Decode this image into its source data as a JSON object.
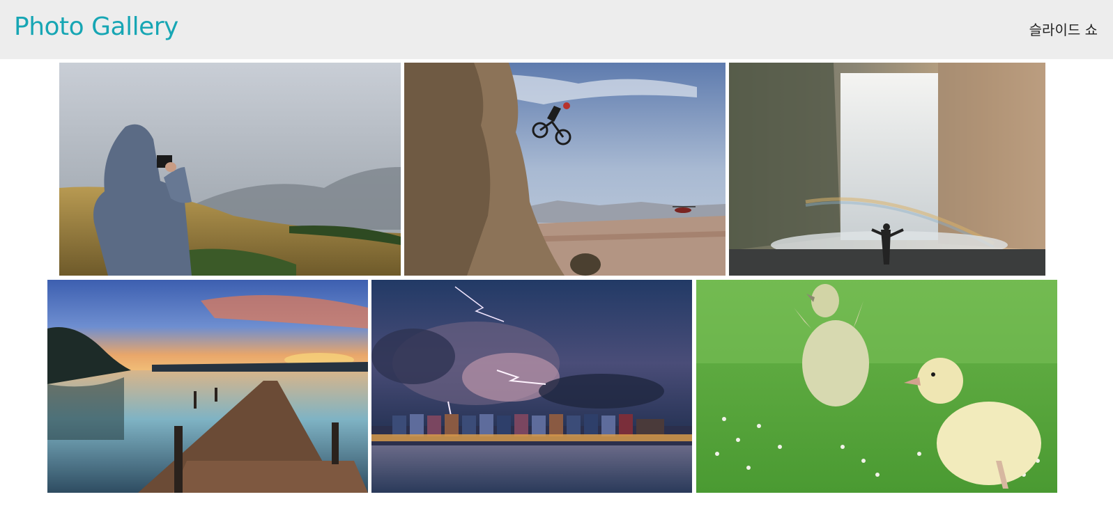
{
  "header": {
    "logo_text": "Photo Gallery",
    "slideshow_label": "슬라이드 쇼",
    "background_color": "#ededed",
    "logo_color": "#17a6b4"
  },
  "gallery": {
    "rows": [
      {
        "photos": [
          {
            "subject": "hooded-person-photographing-misty-landscape"
          },
          {
            "subject": "mountain-bike-jump-off-cliff"
          },
          {
            "subject": "waterfall-with-rainbow"
          }
        ]
      },
      {
        "photos": [
          {
            "subject": "wooden-pier-at-sunset-lake"
          },
          {
            "subject": "lightning-storm-over-colorful-houses"
          },
          {
            "subject": "ducklings-on-grass"
          }
        ]
      }
    ]
  }
}
